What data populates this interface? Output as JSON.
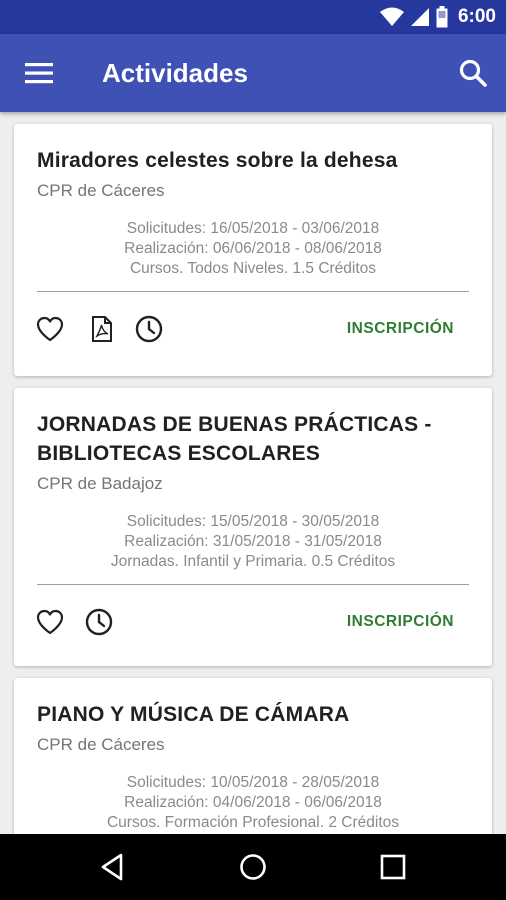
{
  "status_bar": {
    "time": "6:00"
  },
  "app_bar": {
    "title": "Actividades"
  },
  "cards": [
    {
      "title": "Miradores celestes sobre la dehesa",
      "center": "CPR de Cáceres",
      "solicitudes": "Solicitudes: 16/05/2018 - 03/06/2018",
      "realizacion": "Realización: 06/06/2018 - 08/06/2018",
      "details": "Cursos. Todos Niveles. 1.5 Créditos",
      "action_label": "INSCRIPCIÓN"
    },
    {
      "title": "JORNADAS DE BUENAS PRÁCTICAS - BIBLIOTECAS ESCOLARES",
      "center": "CPR de Badajoz",
      "solicitudes": "Solicitudes: 15/05/2018 - 30/05/2018",
      "realizacion": "Realización: 31/05/2018 - 31/05/2018",
      "details": "Jornadas. Infantil y Primaria. 0.5 Créditos",
      "action_label": "INSCRIPCIÓN"
    },
    {
      "title": "PIANO Y MÚSICA DE CÁMARA",
      "center": "CPR de Cáceres",
      "solicitudes": "Solicitudes: 10/05/2018 - 28/05/2018",
      "realizacion": "Realización: 04/06/2018 - 06/06/2018",
      "details": "Cursos. Formación Profesional. 2 Créditos"
    }
  ],
  "colors": {
    "primary": "#3f51b5",
    "primary_dark": "#26379d",
    "action_green": "#2e7d32"
  }
}
